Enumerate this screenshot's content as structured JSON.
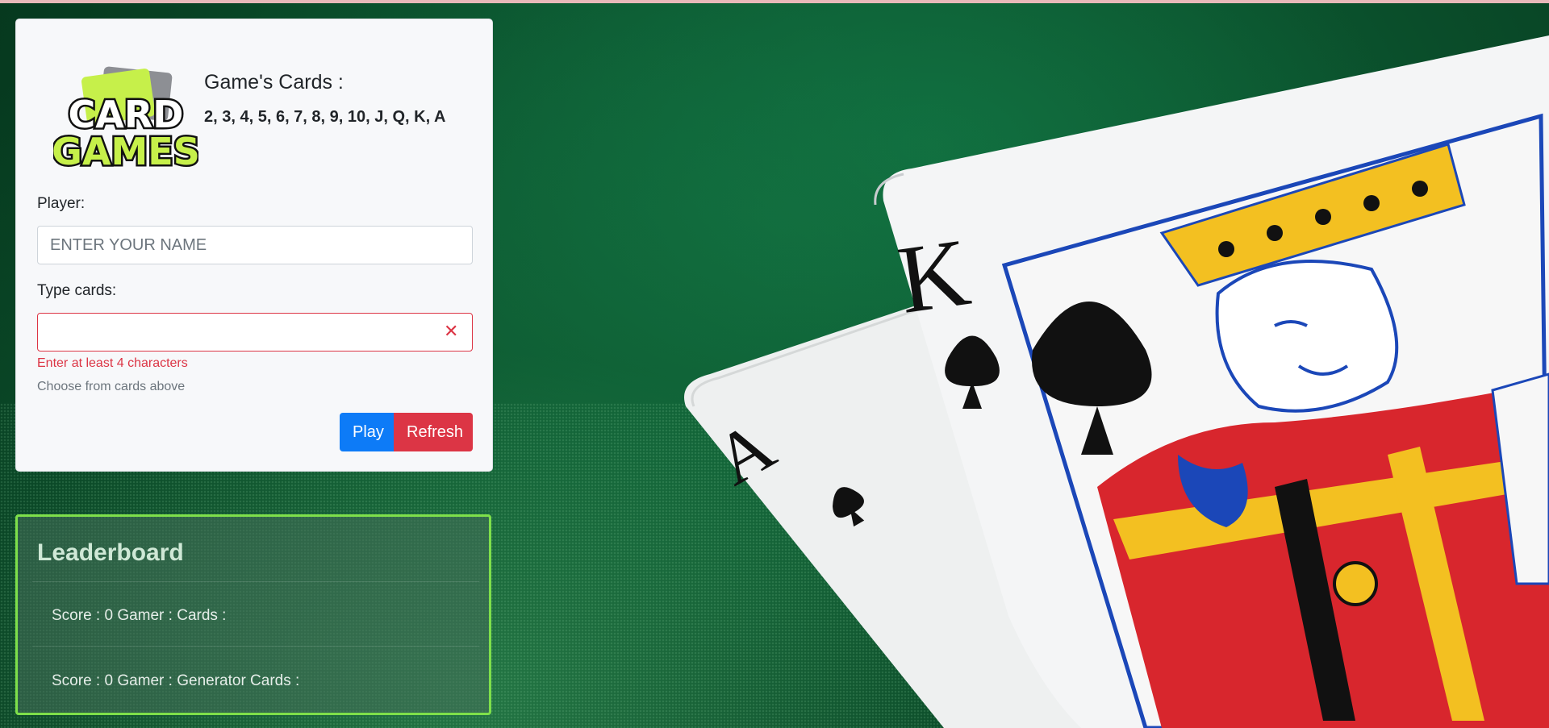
{
  "header": {
    "logo_line1": "CARD",
    "logo_line2": "GAMES",
    "games_title": "Game's Cards :",
    "games_list": "2, 3, 4, 5, 6, 7, 8, 9, 10, J, Q, K, A"
  },
  "form": {
    "player_label": "Player:",
    "player_placeholder": "ENTER YOUR NAME",
    "player_value": "",
    "cards_label": "Type cards:",
    "cards_value": "",
    "error_text": "Enter at least 4 characters",
    "help_text": "Choose from cards above",
    "play_label": "Play",
    "refresh_label": "Refresh"
  },
  "leaderboard": {
    "title": "Leaderboard",
    "rows": [
      "Score : 0 Gamer : Cards :",
      "Score : 0 Gamer : Generator Cards :"
    ]
  },
  "colors": {
    "primary": "#0d7bf7",
    "danger": "#dc3545",
    "leaderboard_border": "#7ee04a"
  }
}
